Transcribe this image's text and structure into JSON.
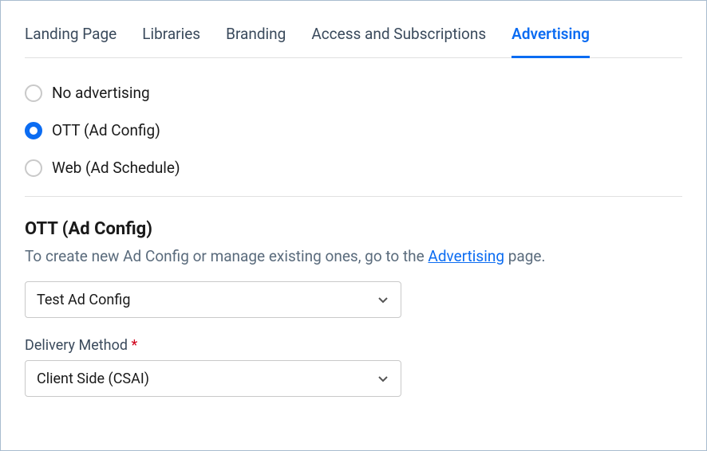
{
  "tabs": {
    "items": [
      {
        "label": "Landing Page",
        "active": false
      },
      {
        "label": "Libraries",
        "active": false
      },
      {
        "label": "Branding",
        "active": false
      },
      {
        "label": "Access and Subscriptions",
        "active": false
      },
      {
        "label": "Advertising",
        "active": true
      }
    ]
  },
  "radios": {
    "noAdvertising": "No advertising",
    "ott": "OTT (Ad Config)",
    "web": "Web (Ad Schedule)"
  },
  "section": {
    "title": "OTT (Ad Config)",
    "descPrefix": "To create new Ad Config or manage existing ones, go to the ",
    "descLink": "Advertising",
    "descSuffix": " page."
  },
  "selects": {
    "adConfigValue": "Test Ad Config",
    "deliveryLabel": "Delivery Method",
    "deliveryValue": "Client Side (CSAI)"
  }
}
